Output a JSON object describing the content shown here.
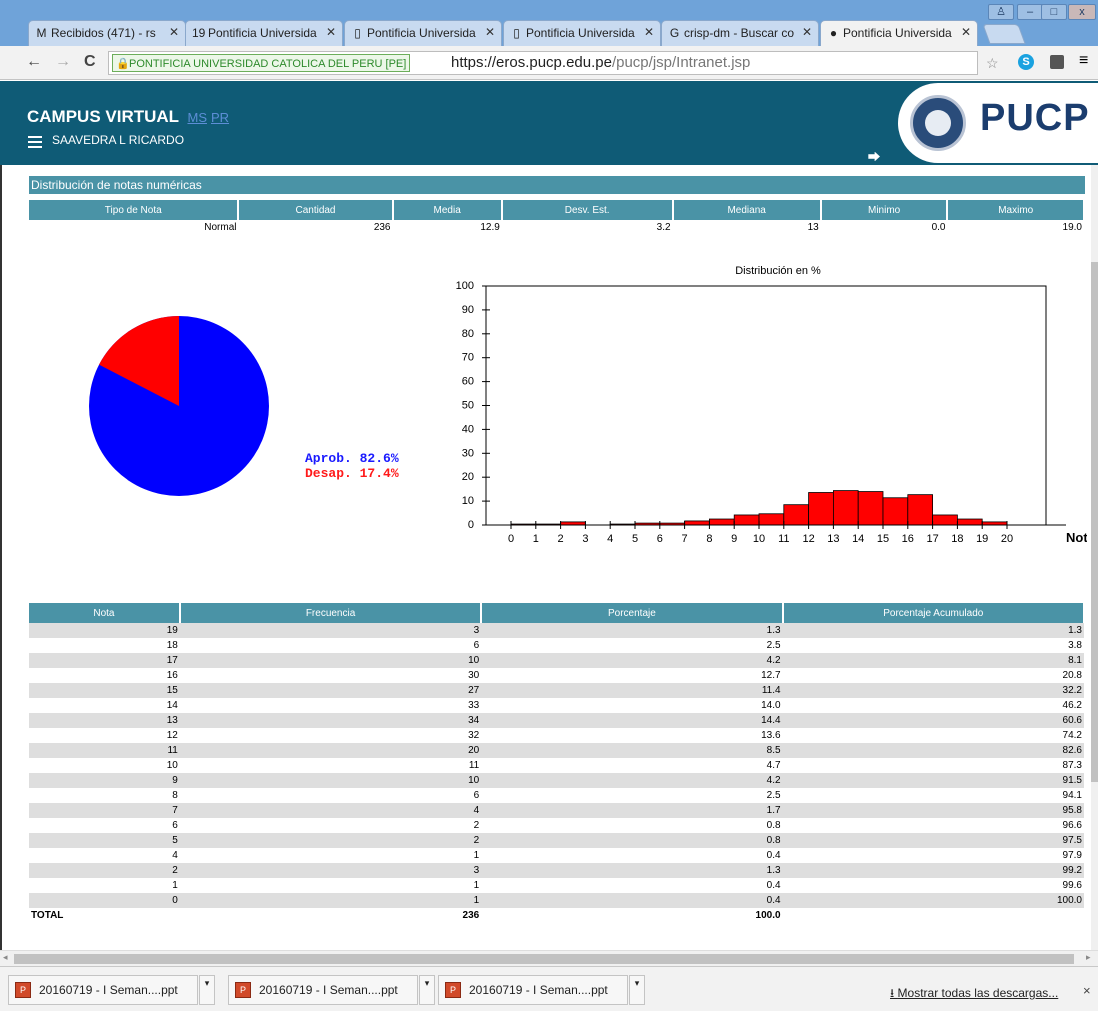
{
  "browser": {
    "tabs": [
      {
        "label": "Recibidos (471) - rs",
        "icon": "gmail-icon",
        "glyph": "M",
        "active": false
      },
      {
        "label": "Pontificia Universida",
        "icon": "calendar-icon",
        "glyph": "19",
        "active": false
      },
      {
        "label": "Pontificia Universida",
        "icon": "page-icon",
        "glyph": "▯",
        "active": false
      },
      {
        "label": "Pontificia Universida",
        "icon": "page-icon",
        "glyph": "▯",
        "active": false
      },
      {
        "label": "crisp-dm - Buscar co",
        "icon": "google-icon",
        "glyph": "G",
        "active": false
      },
      {
        "label": "Pontificia Universida",
        "icon": "pucp-icon",
        "glyph": "●",
        "active": true
      }
    ],
    "security_badge": "PONTIFICIA UNIVERSIDAD CATOLICA DEL PERU [PE]",
    "url_host": "https://eros.pucp.edu.pe",
    "url_path": "/pucp/jsp/Intranet.jsp"
  },
  "header": {
    "title": "CAMPUS VIRTUAL",
    "link_ms": "MS",
    "link_pr": "PR",
    "user": "SAAVEDRA L RICARDO",
    "logo_text": "PUCP"
  },
  "stats": {
    "section_title": "Distribución de notas numéricas",
    "columns": [
      "Tipo de Nota",
      "Cantidad",
      "Media",
      "Desv. Est.",
      "Mediana",
      "Minimo",
      "Maximo"
    ],
    "row": [
      "Normal",
      "236",
      "12.9",
      "3.2",
      "13",
      "0.0",
      "19.0"
    ]
  },
  "pie": {
    "aprob_label": "Aprob. 82.6%",
    "desap_label": "Desap. 17.4%",
    "aprob_pct": 82.6,
    "desap_pct": 17.4,
    "aprob_color": "#0000ff",
    "desap_color": "#ff0000"
  },
  "chart_data": {
    "type": "bar",
    "title": "Distribución en %",
    "xlabel": "Notas",
    "ylabel": "",
    "ylim": [
      0,
      100
    ],
    "yticks": [
      0,
      10,
      20,
      30,
      40,
      50,
      60,
      70,
      80,
      90,
      100
    ],
    "categories": [
      "0",
      "1",
      "2",
      "3",
      "4",
      "5",
      "6",
      "7",
      "8",
      "9",
      "10",
      "11",
      "12",
      "13",
      "14",
      "15",
      "16",
      "17",
      "18",
      "19",
      "20"
    ],
    "values": [
      0.4,
      0.4,
      1.3,
      0,
      0.4,
      0.8,
      0.8,
      1.7,
      2.5,
      4.2,
      4.7,
      8.5,
      13.6,
      14.4,
      14.0,
      11.4,
      12.7,
      4.2,
      2.5,
      1.3,
      0
    ],
    "bar_color": "#ff0000"
  },
  "freq_table": {
    "columns": [
      "Nota",
      "Frecuencia",
      "Porcentaje",
      "Porcentaje Acumulado"
    ],
    "rows": [
      [
        "19",
        "3",
        "1.3",
        "1.3"
      ],
      [
        "18",
        "6",
        "2.5",
        "3.8"
      ],
      [
        "17",
        "10",
        "4.2",
        "8.1"
      ],
      [
        "16",
        "30",
        "12.7",
        "20.8"
      ],
      [
        "15",
        "27",
        "11.4",
        "32.2"
      ],
      [
        "14",
        "33",
        "14.0",
        "46.2"
      ],
      [
        "13",
        "34",
        "14.4",
        "60.6"
      ],
      [
        "12",
        "32",
        "13.6",
        "74.2"
      ],
      [
        "11",
        "20",
        "8.5",
        "82.6"
      ],
      [
        "10",
        "11",
        "4.7",
        "87.3"
      ],
      [
        "9",
        "10",
        "4.2",
        "91.5"
      ],
      [
        "8",
        "6",
        "2.5",
        "94.1"
      ],
      [
        "7",
        "4",
        "1.7",
        "95.8"
      ],
      [
        "6",
        "2",
        "0.8",
        "96.6"
      ],
      [
        "5",
        "2",
        "0.8",
        "97.5"
      ],
      [
        "4",
        "1",
        "0.4",
        "97.9"
      ],
      [
        "2",
        "3",
        "1.3",
        "99.2"
      ],
      [
        "1",
        "1",
        "0.4",
        "99.6"
      ],
      [
        "0",
        "1",
        "0.4",
        "100.0"
      ]
    ],
    "total_label": "TOTAL",
    "total_freq": "236",
    "total_pct": "100.0"
  },
  "downloads": {
    "items": [
      "20160719 - I Seman....ppt",
      "20160719 - I Seman....ppt",
      "20160719 - I Seman....ppt"
    ],
    "show_all": "Mostrar todas las descargas..."
  }
}
